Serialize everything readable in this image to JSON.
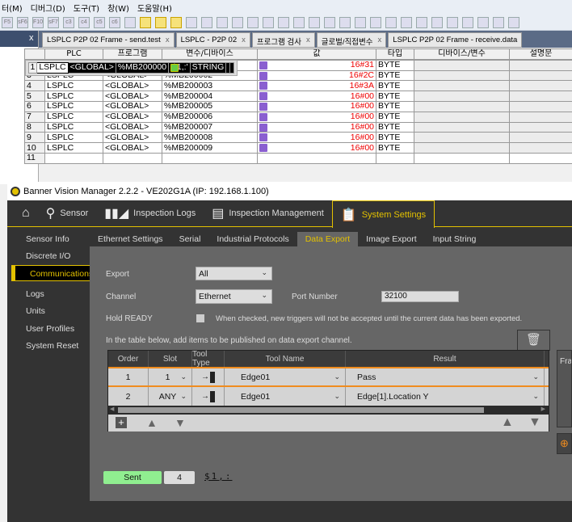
{
  "menubar": {
    "items": [
      "터(M)",
      "디버그(D)",
      "도구(T)",
      "창(W)",
      "도움말(H)"
    ]
  },
  "toolbar": {
    "keys": [
      "F5",
      "sF6",
      "F10",
      "sF7",
      "c3",
      "c4",
      "c5",
      "c6"
    ]
  },
  "left_panel": {
    "close": "x"
  },
  "doc_tabs": [
    {
      "label": "LSPLC P2P 02 Frame - send.test",
      "close": "x"
    },
    {
      "label": "LSPLC - P2P 02",
      "close": "x"
    },
    {
      "label": "프로그램 검사",
      "close": "x"
    },
    {
      "label": "글로벌/직접변수",
      "close": "x"
    },
    {
      "label": "LSPLC P2P 02 Frame - receive.data",
      "close": ""
    }
  ],
  "grid": {
    "headers": [
      "",
      "PLC",
      "프로그램",
      "변수/디바이스",
      "값",
      "타입",
      "디바이스/변수",
      "설명문"
    ],
    "rows": [
      {
        "n": "1",
        "plc": "LSPLC",
        "prog": "<GLOBAL>",
        "dev": "%MB200000",
        "val": "'$1,:'",
        "type": "STRING"
      },
      {
        "n": "2",
        "plc": "LSPLC",
        "prog": "<GLOBAL>",
        "dev": "%MB200001",
        "val": "16#31",
        "type": "BYTE"
      },
      {
        "n": "3",
        "plc": "LSPLC",
        "prog": "<GLOBAL>",
        "dev": "%MB200002",
        "val": "16#2C",
        "type": "BYTE"
      },
      {
        "n": "4",
        "plc": "LSPLC",
        "prog": "<GLOBAL>",
        "dev": "%MB200003",
        "val": "16#3A",
        "type": "BYTE"
      },
      {
        "n": "5",
        "plc": "LSPLC",
        "prog": "<GLOBAL>",
        "dev": "%MB200004",
        "val": "16#00",
        "type": "BYTE"
      },
      {
        "n": "6",
        "plc": "LSPLC",
        "prog": "<GLOBAL>",
        "dev": "%MB200005",
        "val": "16#00",
        "type": "BYTE"
      },
      {
        "n": "7",
        "plc": "LSPLC",
        "prog": "<GLOBAL>",
        "dev": "%MB200006",
        "val": "16#00",
        "type": "BYTE"
      },
      {
        "n": "8",
        "plc": "LSPLC",
        "prog": "<GLOBAL>",
        "dev": "%MB200007",
        "val": "16#00",
        "type": "BYTE"
      },
      {
        "n": "9",
        "plc": "LSPLC",
        "prog": "<GLOBAL>",
        "dev": "%MB200008",
        "val": "16#00",
        "type": "BYTE"
      },
      {
        "n": "10",
        "plc": "LSPLC",
        "prog": "<GLOBAL>",
        "dev": "%MB200009",
        "val": "16#00",
        "type": "BYTE"
      },
      {
        "n": "11",
        "plc": "",
        "prog": "",
        "dev": "",
        "val": "",
        "type": ""
      }
    ]
  },
  "bvm": {
    "title": "Banner Vision Manager 2.2.2 - VE202G1A (IP: 192.168.1.100)",
    "nav": [
      {
        "label": "",
        "icon": "home-icon"
      },
      {
        "label": "Sensor",
        "icon": "sensor-icon"
      },
      {
        "label": "Inspection Logs",
        "icon": "books-icon"
      },
      {
        "label": "Inspection Management",
        "icon": "list-icon"
      },
      {
        "label": "System Settings",
        "icon": "settings-clipboard-icon",
        "active": true
      }
    ],
    "sidebar": [
      "Sensor Info",
      "Discrete I/O",
      "Communications",
      "Logs",
      "Units",
      "User Profiles",
      "System Reset"
    ],
    "sidebar_active": "Communications",
    "subtabs": [
      "Ethernet Settings",
      "Serial",
      "Industrial Protocols",
      "Data Export",
      "Image Export",
      "Input String"
    ],
    "subtab_active": "Data Export",
    "export": {
      "label": "Export",
      "value": "All"
    },
    "channel": {
      "label": "Channel",
      "value": "Ethernet"
    },
    "port": {
      "label": "Port Number",
      "value": "32100"
    },
    "hold": {
      "label": "Hold READY",
      "checked": false,
      "text": "When checked, new triggers will not be accepted until the current data has been exported."
    },
    "instruction": "In the table below, add items to be published on data export channel.",
    "table": {
      "headers": [
        "Order",
        "Slot",
        "Tool Type",
        "Tool Name",
        "Result"
      ],
      "rows": [
        {
          "order": "1",
          "slot": "1",
          "tool_name": "Edge01",
          "result": "Pass"
        },
        {
          "order": "2",
          "slot": "ANY",
          "tool_name": "Edge01",
          "result": "Edge[1].Location Y"
        }
      ]
    },
    "frame_panel": "Fra",
    "status": {
      "label": "Sent",
      "count": "4",
      "string": "$1,:"
    },
    "colors": {
      "accent": "#e3c100",
      "row_separator": "#f08c1e",
      "sent": "#90ee90"
    }
  }
}
